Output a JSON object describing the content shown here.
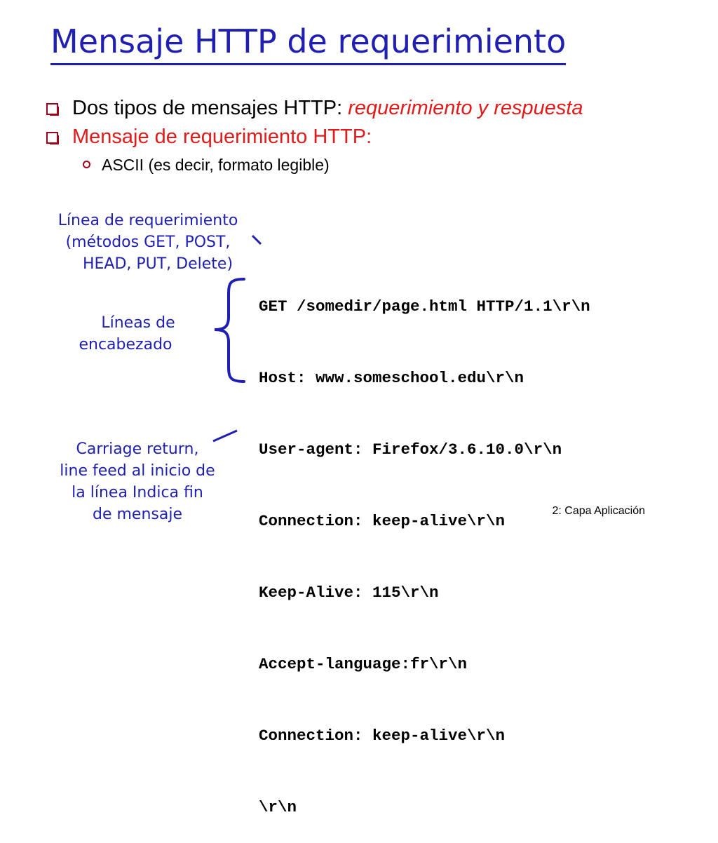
{
  "title": "Mensaje HTTP de requerimiento",
  "bullets": [
    {
      "prefix": "Dos tipos de mensajes HTTP: ",
      "emphasis": "requerimiento y respuesta"
    },
    {
      "text": "Mensaje de requerimiento HTTP:"
    }
  ],
  "sub_bullet": "ASCII  (es decir, formato legible)",
  "annotations": {
    "request_line": [
      "Línea de requerimiento",
      "(métodos GET, POST,",
      "HEAD, PUT, Delete)"
    ],
    "header_lines": [
      "Líneas de",
      "encabezado"
    ],
    "crlf": [
      "Carriage return,",
      "line feed al inicio de",
      "la línea Indica fin",
      "de mensaje"
    ]
  },
  "http_request": [
    "GET /somedir/page.html HTTP/1.1\\r\\n",
    "Host: www.someschool.edu\\r\\n",
    "User-agent: Firefox/3.6.10.0\\r\\n",
    "Connection: keep-alive\\r\\n",
    "Keep-Alive: 115\\r\\n",
    "Accept-language:fr\\r\\n",
    "Connection: keep-alive\\r\\n",
    "\\r\\n"
  ],
  "footer": "2: Capa Aplicación",
  "colors": {
    "title": "#1f1fb4",
    "annotation": "#1f1fb4",
    "emphasis": "#e21a1a",
    "bullet_box": "#a0001a"
  }
}
